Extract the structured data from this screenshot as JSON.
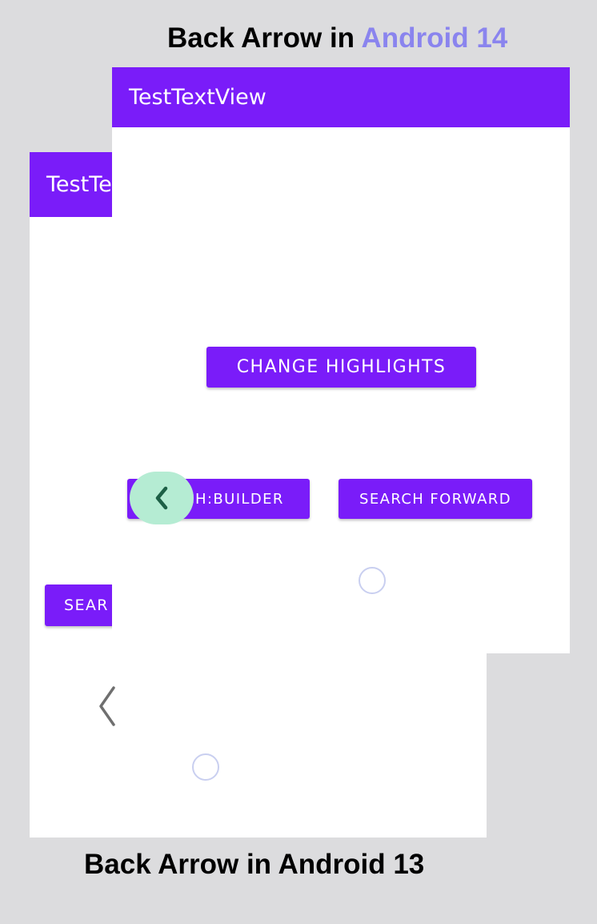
{
  "headings": {
    "top_prefix": "Back Arrow in ",
    "top_accent": "Android 14",
    "bottom": "Back Arrow in Android 13"
  },
  "android13": {
    "app_title": "TestTe",
    "search_button_label": "SEAR",
    "back_icon": "chevron-left-icon"
  },
  "android14": {
    "app_title": "TestTextView",
    "change_highlights_label": "CHANGE HIGHLIGHTS",
    "search_builder_label": "CH:BUILDER",
    "search_forward_label": "SEARCH FORWARD",
    "back_icon": "chevron-left-icon"
  },
  "colors": {
    "background": "#dcdcde",
    "accent_text": "#8a84ee",
    "primary": "#7a1cf9",
    "back_pill": "#b5ecd3",
    "back_arrow": "#1d6046",
    "touch_ring": "#c9cff0"
  }
}
